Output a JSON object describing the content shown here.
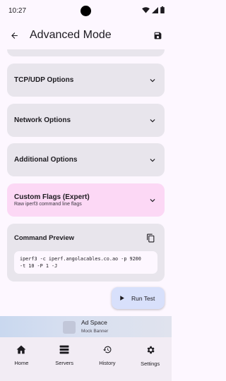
{
  "status_bar": {
    "time": "10:27"
  },
  "app_bar": {
    "title": "Advanced Mode"
  },
  "sections": [
    {
      "label": "TCP/UDP Options"
    },
    {
      "label": "Network Options"
    },
    {
      "label": "Additional Options"
    }
  ],
  "custom_flags": {
    "label": "Custom Flags (Expert)",
    "subtitle": "Raw iperf3 command line flags"
  },
  "command_preview": {
    "label": "Command Preview",
    "line1": "iperf3 -c iperf.angolacables.co.ao -p 9200",
    "line2": "-t 10 -P 1 -J"
  },
  "run_button": {
    "label": "Run Test"
  },
  "ad": {
    "title": "Ad Space",
    "subtitle": "Mock Banner"
  },
  "nav": [
    {
      "label": "Home"
    },
    {
      "label": "Servers"
    },
    {
      "label": "History"
    },
    {
      "label": "Settings"
    }
  ],
  "colors": {
    "background": "#fdf7ff",
    "card": "#e8e5ec",
    "pink_card": "#fcd8f5",
    "fab": "#d8e0fb",
    "nav": "#f2ecf4"
  }
}
